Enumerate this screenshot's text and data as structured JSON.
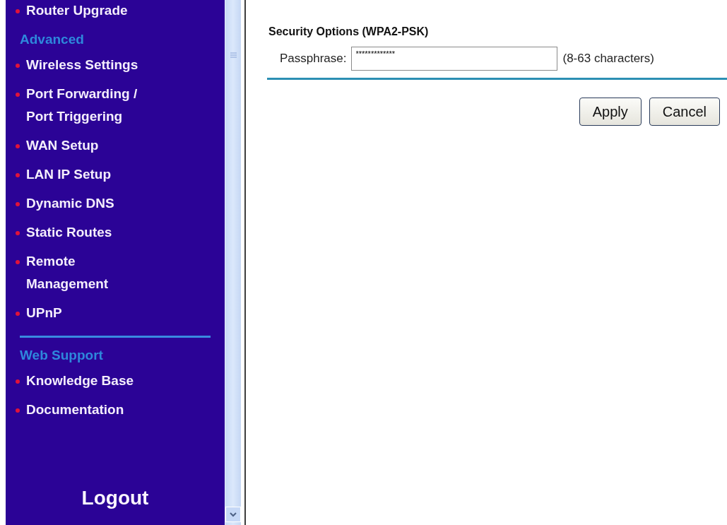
{
  "sidebar": {
    "sections": [
      {
        "items": [
          "Router Upgrade"
        ]
      },
      {
        "heading": "Advanced",
        "items": [
          "Wireless Settings",
          "Port Forwarding / Port Triggering",
          "WAN Setup",
          "LAN IP Setup",
          "Dynamic DNS",
          "Static Routes",
          "Remote Management",
          "UPnP"
        ]
      },
      {
        "heading": "Web Support",
        "divider_above": true,
        "items": [
          "Knowledge Base",
          "Documentation"
        ]
      }
    ],
    "logout": "Logout"
  },
  "content": {
    "heading": "Security Options (WPA2-PSK)",
    "passphrase": {
      "label": "Passphrase:",
      "value": "*************",
      "hint": "(8-63 characters)"
    },
    "buttons": [
      "Apply",
      "Cancel"
    ]
  }
}
